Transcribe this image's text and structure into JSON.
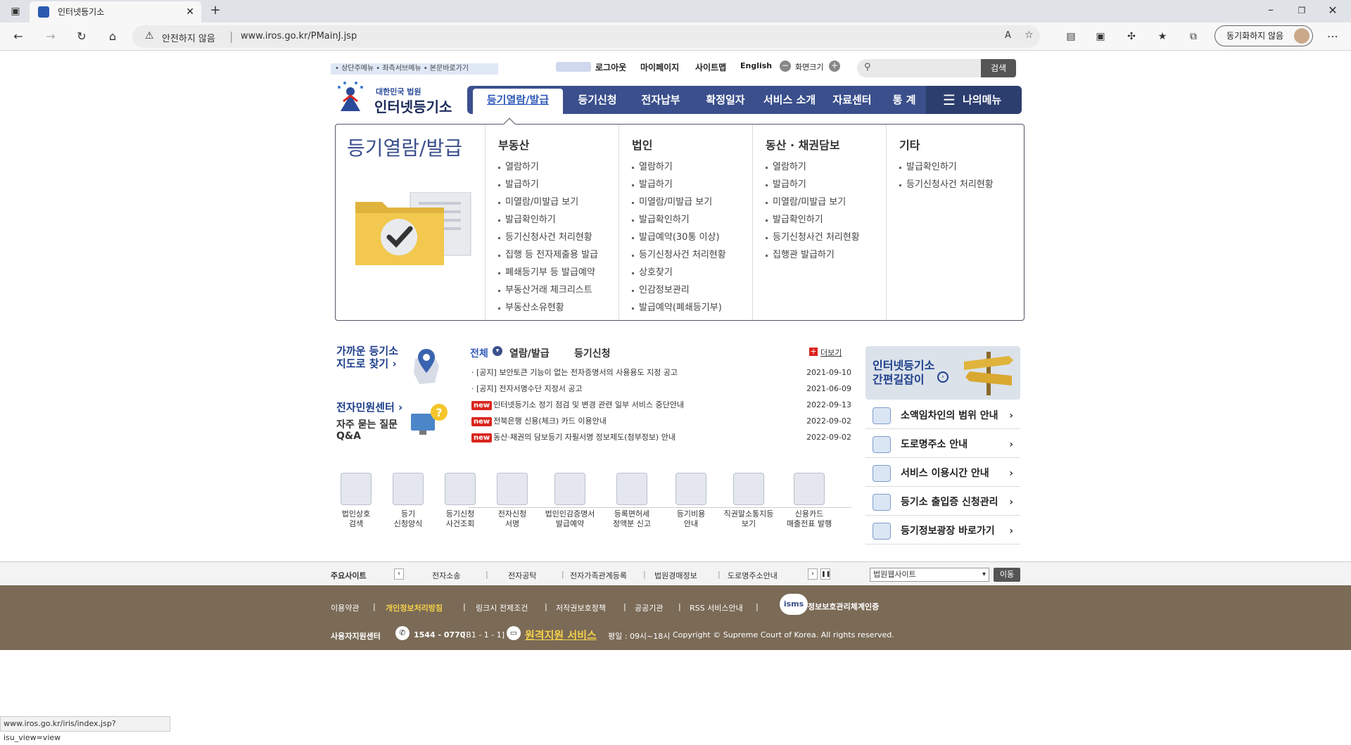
{
  "browser": {
    "tab_title": "인터넷등기소",
    "security_label": "안전하지 않음",
    "url": "www.iros.go.kr/PMainJ.jsp",
    "sync_label": "동기화하지 않음",
    "status_url": "www.iros.go.kr/iris/index.jsp?isu_view=view"
  },
  "header": {
    "skip_links": "• 상단주메뉴 • 좌측서브메뉴 • 본문바로가기",
    "logout": "로그아웃",
    "mypage": "마이페이지",
    "sitemap": "사이트맵",
    "english": "English",
    "zoom_label": "화면크기",
    "search_button": "검색",
    "logo_small": "대한민국 법원",
    "logo_big": "인터넷등기소"
  },
  "gnb": {
    "items": [
      "등기열람/발급",
      "등기신청",
      "전자납부",
      "확정일자",
      "서비스 소개",
      "자료센터",
      "통 계"
    ],
    "mymenu": "나의메뉴"
  },
  "dropdown": {
    "title": "등기열람/발급",
    "columns": [
      {
        "heading": "부동산",
        "items": [
          "열람하기",
          "발급하기",
          "미열람/미발급 보기",
          "발급확인하기",
          "등기신청사건 처리현황",
          "집행 등 전자제출용 발급",
          "폐쇄등기부 등 발급예약",
          "부동산거래 체크리스트",
          "부동산소유현황"
        ]
      },
      {
        "heading": "법인",
        "items": [
          "열람하기",
          "발급하기",
          "미열람/미발급 보기",
          "발급확인하기",
          "발급예약(30통 이상)",
          "등기신청사건 처리현황",
          "상호찾기",
          "인감정보관리",
          "발급예약(폐쇄등기부)"
        ]
      },
      {
        "heading": "동산 · 채권담보",
        "items": [
          "열람하기",
          "발급하기",
          "미열람/미발급 보기",
          "발급확인하기",
          "등기신청사건 처리현황",
          "집행관 발급하기"
        ]
      },
      {
        "heading": "기타",
        "items": [
          "발급확인하기",
          "등기신청사건 처리현황"
        ]
      }
    ]
  },
  "left": {
    "map_line1": "가까운 등기소",
    "map_line2": "지도로 찾기 ›",
    "civil": "전자민원센터 ›",
    "faq1": "자주 묻는 질문",
    "faq2": "Q&A"
  },
  "notices": {
    "tabs": [
      "전체",
      "열람/발급",
      "등기신청"
    ],
    "more": "더보기",
    "new_badge": "new",
    "items": [
      {
        "text": "[공지] 보안토큰 기능이 없는 전자증명서의 사용용도 지정 공고",
        "date": "2021-09-10",
        "isnew": false
      },
      {
        "text": "[공지] 전자서명수단 지정서 공고",
        "date": "2021-06-09",
        "isnew": false
      },
      {
        "text": "인터넷등기소 정기 점검 및 변경 관련 일부 서비스 중단안내",
        "date": "2022-09-13",
        "isnew": true
      },
      {
        "text": "전북은행 신용(체크) 카드 이용안내",
        "date": "2022-09-02",
        "isnew": true
      },
      {
        "text": "동산·채권의 담보등기 자필서명 정보제도(첨부정보) 안내",
        "date": "2022-09-02",
        "isnew": true
      }
    ]
  },
  "quick": [
    {
      "line1": "법인상호",
      "line2": "검색"
    },
    {
      "line1": "등기",
      "line2": "신청양식"
    },
    {
      "line1": "등기신청",
      "line2": "사건조회"
    },
    {
      "line1": "전자신청",
      "line2": "서명"
    },
    {
      "line1": "법인인감증명서",
      "line2": "발급예약"
    },
    {
      "line1": "등록면허세",
      "line2": "정액분 신고"
    },
    {
      "line1": "등기비용",
      "line2": "안내"
    },
    {
      "line1": "직권말소통지등",
      "line2": "보기"
    },
    {
      "line1": "신용카드",
      "line2": "매출전표 발행"
    }
  ],
  "right": {
    "guide1": "인터넷등기소",
    "guide2": "간편길잡이",
    "links": [
      "소액임차인의 범위 안내",
      "도로명주소 안내",
      "서비스 이용시간 안내",
      "등기소 출입증 신청관리",
      "등기정보광장 바로가기"
    ]
  },
  "sitebar": {
    "label": "주요사이트",
    "items": [
      "전자소송",
      "전자공탁",
      "전자가족관계등록",
      "법원경매정보",
      "도로명주소안내"
    ],
    "select": "법원웹사이트",
    "go": "이동"
  },
  "footer": {
    "links": [
      "이용약관",
      "개인정보처리방침",
      "링크시 전제조건",
      "저작권보호정책",
      "공공기관",
      "RSS 서비스안내"
    ],
    "isms": "정보보호관리체계인증",
    "support": "사용자지원센터",
    "phone": "1544 - 0770",
    "phone_sub": "[B1 - 1 - 1]",
    "remote": "원격지원 서비스",
    "hours": "평일 : 09시~18시",
    "copyright": "Copyright © Supreme Court of Korea. All rights reserved."
  },
  "colors": {
    "primary": "#3a4f8c",
    "footer": "#7a6a56",
    "new": "#d9251d",
    "highlight": "#f5d04a"
  }
}
